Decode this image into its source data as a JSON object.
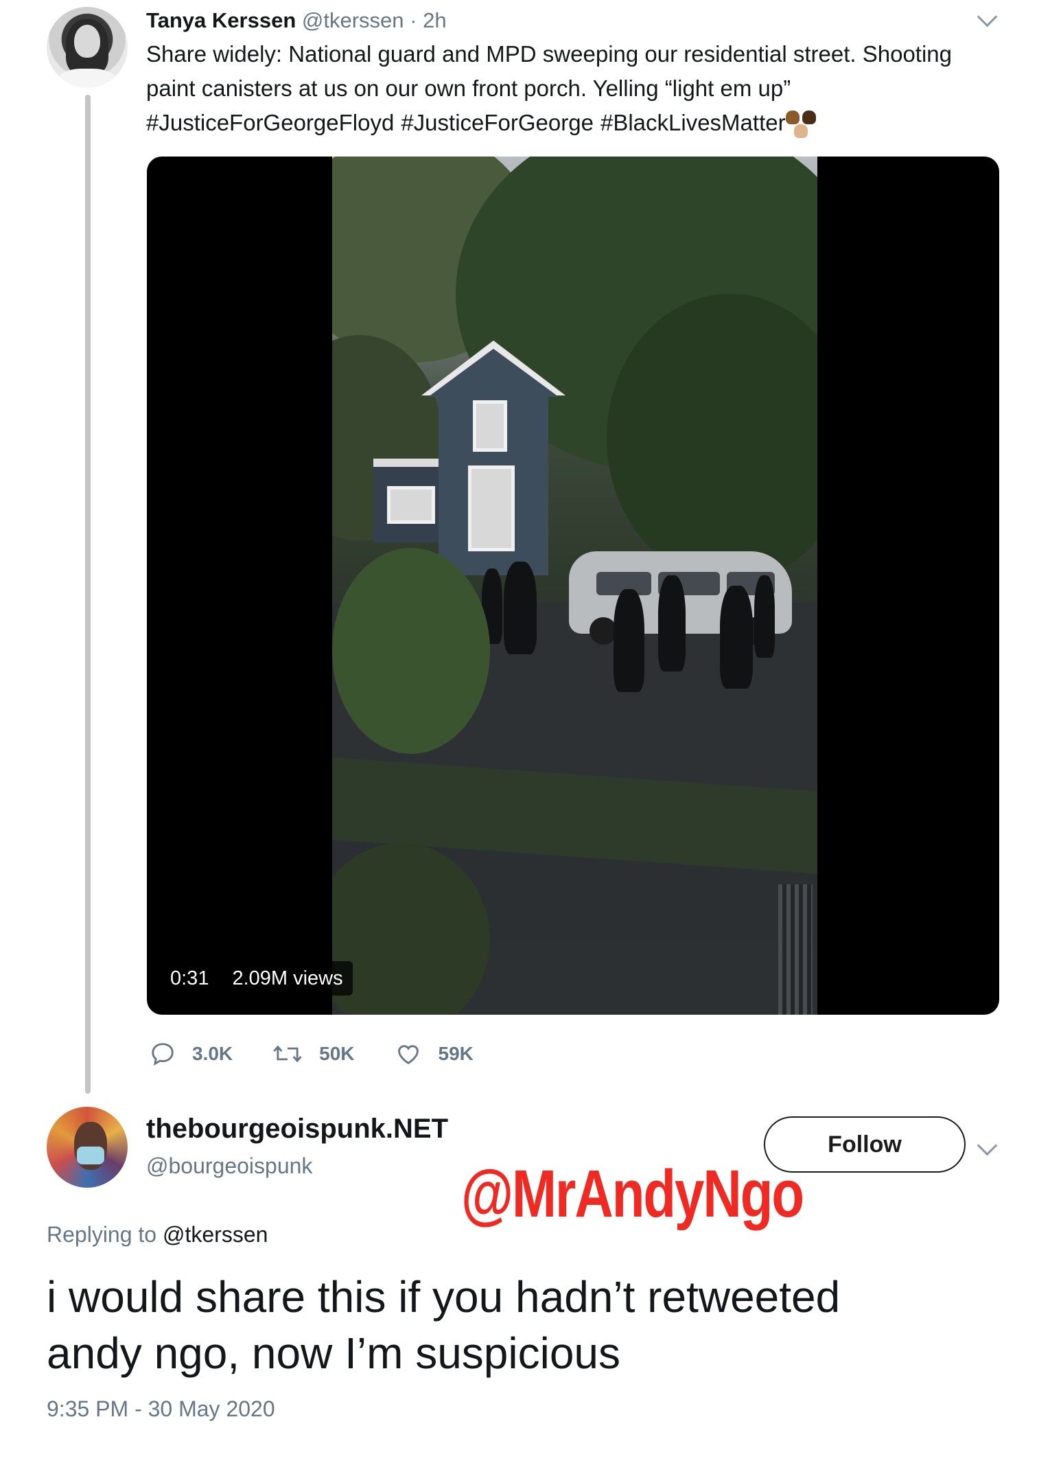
{
  "original_tweet": {
    "display_name": "Tanya Kerssen",
    "handle": "@tkerssen",
    "separator": "·",
    "time": "2h",
    "text_line1": "Share widely: National guard and MPD sweeping our residential street. Shooting",
    "text_line2": "paint canisters at us on our own front porch. Yelling “light em up”",
    "hashtags": [
      "#JusticeForGeorgeFloyd",
      "#JusticeForGeorge",
      "#BlackLivesMatter"
    ],
    "emoji": "raised-fists-emoji",
    "video": {
      "duration": "0:31",
      "views": "2.09M views"
    },
    "actions": {
      "replies": "3.0K",
      "retweets": "50K",
      "likes": "59K"
    },
    "icons": [
      "reply-icon",
      "retweet-icon",
      "like-icon",
      "chevron-down-icon"
    ]
  },
  "reply_tweet": {
    "display_name": "thebourgeoispunk.NET",
    "handle": "@bourgeoispunk",
    "follow_label": "Follow",
    "replying_prefix": "Replying to",
    "replying_to": "@tkerssen",
    "text_line1": "i would share this if you hadn’t retweeted",
    "text_line2": "andy ngo, now I’m suspicious",
    "timestamp": "9:35 PM - 30 May 2020"
  },
  "watermark": "@MrAndyNgo",
  "colors": {
    "text": "#14171a",
    "secondary_text": "#657786",
    "watermark": "#ee2a22",
    "thread_line": "#c4c4c4"
  }
}
